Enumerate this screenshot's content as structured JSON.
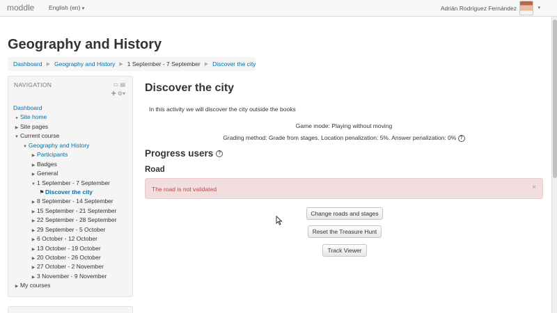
{
  "navbar": {
    "brand": "moddle",
    "language": "English (en)",
    "user_name": "Adrián Rodríguez Fernández"
  },
  "page": {
    "title": "Geography and History"
  },
  "breadcrumb": {
    "items": [
      "Dashboard",
      "Geography and History",
      "1 September - 7 September",
      "Discover the city"
    ]
  },
  "navigation": {
    "title": "NAVIGATION",
    "items": [
      {
        "label": "Dashboard"
      },
      {
        "label": "Site home"
      },
      {
        "label": "Site pages"
      },
      {
        "label": "Current course"
      },
      {
        "label": "Geography and History"
      },
      {
        "label": "Participants"
      },
      {
        "label": "Badges"
      },
      {
        "label": "General"
      },
      {
        "label": "1 September - 7 September"
      },
      {
        "label": "Discover the city"
      },
      {
        "label": "8 September - 14 September"
      },
      {
        "label": "15 September - 21 September"
      },
      {
        "label": "22 September - 28 September"
      },
      {
        "label": "29 September - 5 October"
      },
      {
        "label": "6 October - 12 October"
      },
      {
        "label": "13 October - 19 October"
      },
      {
        "label": "20 October - 26 October"
      },
      {
        "label": "27 October - 2 November"
      },
      {
        "label": "3 November - 9 November"
      },
      {
        "label": "My courses"
      }
    ]
  },
  "main": {
    "heading": "Discover the city",
    "intro": "In this activity we will discover the city outside the books",
    "game_mode": "Game mode: Playing without moving",
    "grading": "Grading method: Grade from stages. Location penalization: 5%. Answer penalization: 0%",
    "progress_title": "Progress users",
    "road_title": "Road",
    "alert_text": "The road is not validated",
    "buttons": {
      "change_roads": "Change roads and stages",
      "reset": "Reset the Treasure Hunt",
      "track_viewer": "Track Viewer"
    }
  },
  "icons": {
    "help": "?",
    "close": "×",
    "caret": "▾"
  }
}
